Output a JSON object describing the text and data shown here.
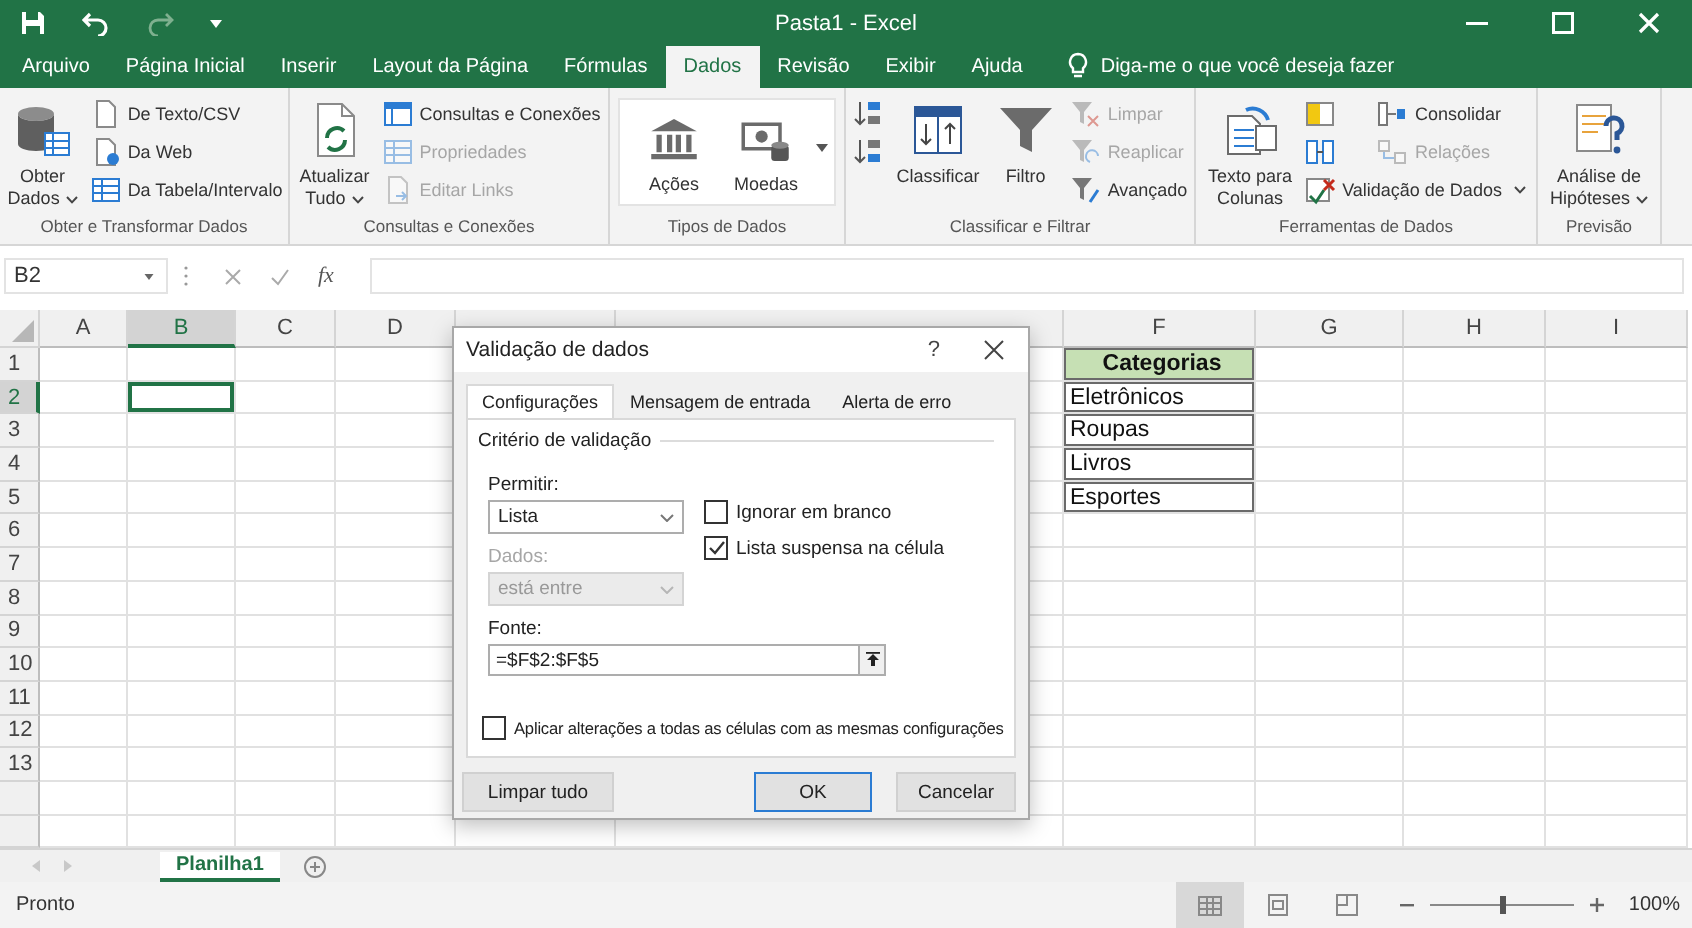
{
  "window": {
    "title": "Pasta1 - Excel"
  },
  "tabs": [
    {
      "label": "Arquivo",
      "selected": false
    },
    {
      "label": "Página Inicial",
      "selected": false
    },
    {
      "label": "Inserir",
      "selected": false
    },
    {
      "label": "Layout da Página",
      "selected": false
    },
    {
      "label": "Fórmulas",
      "selected": false
    },
    {
      "label": "Dados",
      "selected": true
    },
    {
      "label": "Revisão",
      "selected": false
    },
    {
      "label": "Exibir",
      "selected": false
    },
    {
      "label": "Ajuda",
      "selected": false
    }
  ],
  "tell_me": {
    "placeholder": "Diga-me o que você deseja fazer"
  },
  "ribbon_groups": [
    {
      "label": "Obter e Transformar Dados",
      "items": [
        {
          "kind": "large",
          "label": "Obter\nDados",
          "dropdown": true,
          "disabled": false
        },
        {
          "kind": "small",
          "label": "De Texto/CSV",
          "dropdown": false,
          "disabled": false
        },
        {
          "kind": "small",
          "label": "Da Web",
          "dropdown": false,
          "disabled": false
        },
        {
          "kind": "small",
          "label": "Da Tabela/Intervalo",
          "dropdown": false,
          "disabled": false
        }
      ]
    },
    {
      "label": "Consultas e Conexões",
      "items": [
        {
          "kind": "large",
          "label": "Atualizar\nTudo",
          "dropdown": true,
          "disabled": false
        },
        {
          "kind": "small",
          "label": "Consultas e Conexões",
          "dropdown": false,
          "disabled": false
        },
        {
          "kind": "small",
          "label": "Propriedades",
          "dropdown": false,
          "disabled": true
        },
        {
          "kind": "small",
          "label": "Editar Links",
          "dropdown": false,
          "disabled": true
        }
      ]
    },
    {
      "label": "Tipos de Dados",
      "items": [
        {
          "kind": "tile",
          "label": "Ações",
          "disabled": false
        },
        {
          "kind": "tile",
          "label": "Moedas",
          "disabled": false
        }
      ]
    },
    {
      "label": "Classificar e Filtrar",
      "items": [
        {
          "kind": "small",
          "dropdown": false,
          "disabled": false
        },
        {
          "kind": "small",
          "dropdown": false,
          "disabled": false
        },
        {
          "kind": "large",
          "label": "Classificar",
          "dropdown": false,
          "disabled": false
        },
        {
          "kind": "large",
          "label": "Filtro",
          "dropdown": false,
          "disabled": false
        },
        {
          "kind": "small",
          "label": "Limpar",
          "dropdown": false,
          "disabled": true
        },
        {
          "kind": "small",
          "label": "Reaplicar",
          "dropdown": false,
          "disabled": true
        },
        {
          "kind": "small",
          "label": "Avançado",
          "dropdown": false,
          "disabled": false
        }
      ]
    },
    {
      "label": "Ferramentas de Dados",
      "items": [
        {
          "kind": "large",
          "label": "Texto para\nColunas",
          "dropdown": false,
          "disabled": false
        },
        {
          "kind": "small",
          "dropdown": false,
          "disabled": false
        },
        {
          "kind": "small",
          "label": "Consolidar",
          "dropdown": false,
          "disabled": false
        },
        {
          "kind": "small",
          "dropdown": false,
          "disabled": false
        },
        {
          "kind": "small",
          "label": "Relações",
          "dropdown": false,
          "disabled": true
        },
        {
          "kind": "small",
          "label": "Validação de Dados",
          "dropdown": true,
          "disabled": false
        }
      ]
    },
    {
      "label": "Previsão",
      "items": [
        {
          "kind": "large",
          "label": "Análise de\nHipóteses",
          "dropdown": true,
          "disabled": false
        }
      ]
    }
  ],
  "formula_bar": {
    "name_box": "B2",
    "function_label": "fx"
  },
  "sheet": {
    "columns": [
      {
        "label": "A",
        "selected": false
      },
      {
        "label": "B",
        "selected": true
      },
      {
        "label": "C",
        "selected": false
      },
      {
        "label": "D",
        "selected": false
      },
      {
        "selected": false
      },
      {
        "selected": false
      },
      {
        "label": "F",
        "selected": false
      },
      {
        "label": "G",
        "selected": false
      },
      {
        "label": "H",
        "selected": false
      },
      {
        "label": "I",
        "selected": false
      }
    ],
    "rows": [
      {
        "label": "1",
        "selected": false
      },
      {
        "label": "2",
        "selected": true
      },
      {
        "label": "3",
        "selected": false
      },
      {
        "label": "4",
        "selected": false
      },
      {
        "label": "5",
        "selected": false
      },
      {
        "label": "6",
        "selected": false
      },
      {
        "label": "7",
        "selected": false
      },
      {
        "label": "8",
        "selected": false
      },
      {
        "label": "9",
        "selected": false
      },
      {
        "label": "10",
        "selected": false
      },
      {
        "label": "11",
        "selected": false
      },
      {
        "label": "12",
        "selected": false
      },
      {
        "label": "13",
        "selected": false
      },
      {
        "selected": false
      },
      {
        "selected": false
      }
    ],
    "category_table": {
      "header": "Categorias",
      "items": [
        "Eletrônicos",
        "Roupas",
        "Livros",
        "Esportes"
      ]
    }
  },
  "dialog": {
    "title": "Validação de dados",
    "help": "?",
    "tabs": [
      {
        "label": "Configurações",
        "selected": true
      },
      {
        "label": "Mensagem de entrada",
        "selected": false
      },
      {
        "label": "Alerta de erro",
        "selected": false
      }
    ],
    "section": "Critério de validação",
    "allow": {
      "label": "Permitir:",
      "value": "Lista",
      "disabled": false
    },
    "data": {
      "label": "Dados:",
      "value": "está entre",
      "disabled": true
    },
    "options": [
      {
        "label": "Ignorar em branco",
        "checked": false
      },
      {
        "label": "Lista suspensa na célula",
        "checked": true
      }
    ],
    "source": {
      "label": "Fonte:",
      "value": "=$F$2:$F$5"
    },
    "apply_all": {
      "label": "Aplicar alterações a todas as células com as mesmas configurações",
      "checked": false
    },
    "buttons": [
      {
        "label": "Limpar tudo",
        "default": false
      },
      {
        "label": "OK",
        "default": true
      },
      {
        "label": "Cancelar",
        "default": false
      }
    ]
  },
  "sheet_tabs": [
    {
      "label": "Planilha1",
      "selected": true
    }
  ],
  "status_bar": {
    "text": "Pronto",
    "views": [
      {
        "selected": true
      },
      {
        "selected": false
      },
      {
        "selected": false
      }
    ],
    "zoom": {
      "level": 0.5,
      "reading": "100%"
    }
  }
}
